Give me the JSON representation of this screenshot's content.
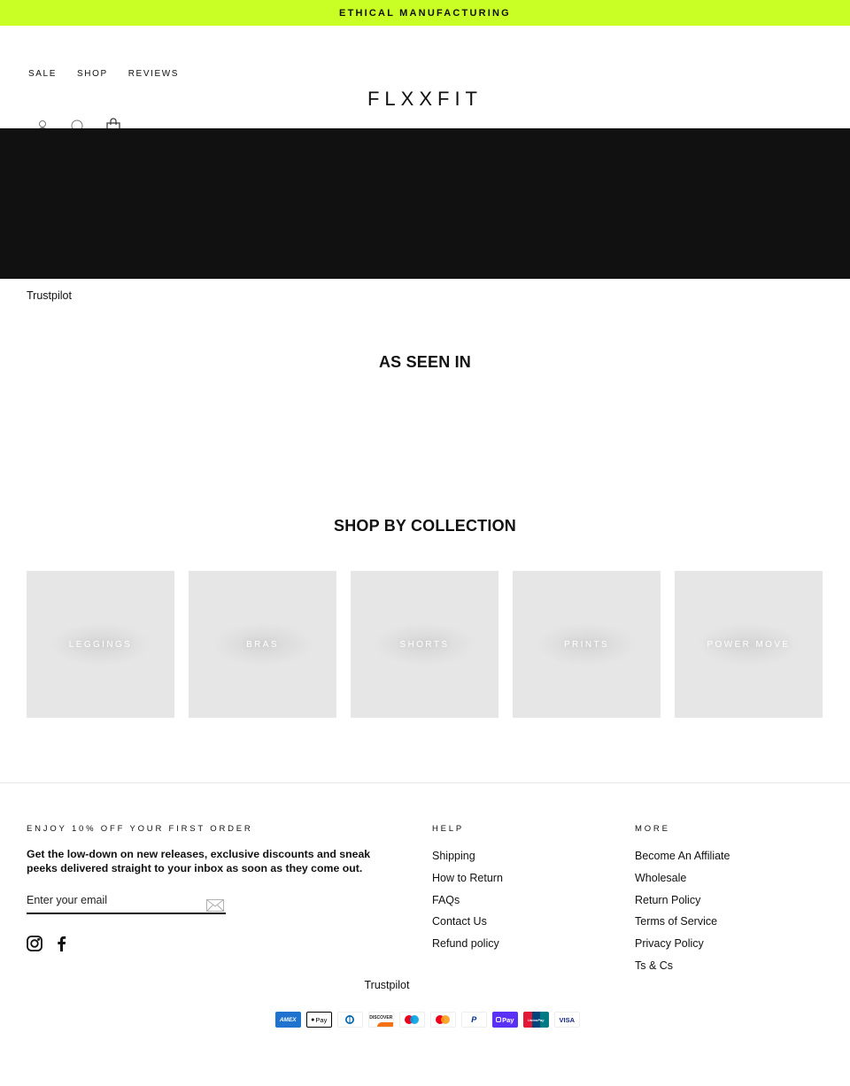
{
  "announcement": {
    "text": "ETHICAL MANUFACTURING",
    "background": "#c9ff24"
  },
  "header": {
    "nav": [
      {
        "label": "SALE"
      },
      {
        "label": "SHOP"
      },
      {
        "label": "REVIEWS"
      }
    ],
    "logo": "FLXXFIT",
    "icons": [
      "account-icon",
      "search-icon",
      "cart-icon"
    ]
  },
  "hero": {
    "background": "#111111"
  },
  "trustpilot_top": "Trustpilot",
  "as_seen_in": {
    "title": "AS SEEN IN"
  },
  "collections": {
    "title": "SHOP BY COLLECTION",
    "items": [
      {
        "label": "LEGGINGS"
      },
      {
        "label": "BRAS"
      },
      {
        "label": "SHORTS"
      },
      {
        "label": "PRINTS"
      },
      {
        "label": "POWER MOVE"
      }
    ]
  },
  "footer": {
    "newsletter": {
      "label": "ENJOY 10% OFF YOUR FIRST ORDER",
      "text": "Get the low-down on new releases, exclusive discounts and sneak peeks delivered straight to your inbox as soon as they come out.",
      "email_placeholder": "Enter your email",
      "email_value": ""
    },
    "social": [
      "instagram-icon",
      "facebook-icon"
    ],
    "help": {
      "label": "HELP",
      "links": [
        "Shipping",
        "How to Return",
        "FAQs",
        "Contact Us",
        "Refund policy"
      ]
    },
    "more": {
      "label": "MORE",
      "links": [
        "Become An Affiliate",
        "Wholesale",
        "Return Policy",
        "Terms of Service",
        "Privacy Policy",
        "Ts & Cs"
      ]
    },
    "trustpilot": "Trustpilot",
    "payments": [
      {
        "name": "American Express",
        "short": "AMEX"
      },
      {
        "name": "Apple Pay",
        "short": "Pay"
      },
      {
        "name": "Diners Club",
        "short": ""
      },
      {
        "name": "Discover",
        "short": "DISCOVER"
      },
      {
        "name": "Maestro",
        "short": ""
      },
      {
        "name": "Mastercard",
        "short": ""
      },
      {
        "name": "PayPal",
        "short": "P"
      },
      {
        "name": "Shop Pay",
        "short": "Pay"
      },
      {
        "name": "Union Pay",
        "short": "UnionPay"
      },
      {
        "name": "Visa",
        "short": "VISA"
      }
    ]
  }
}
